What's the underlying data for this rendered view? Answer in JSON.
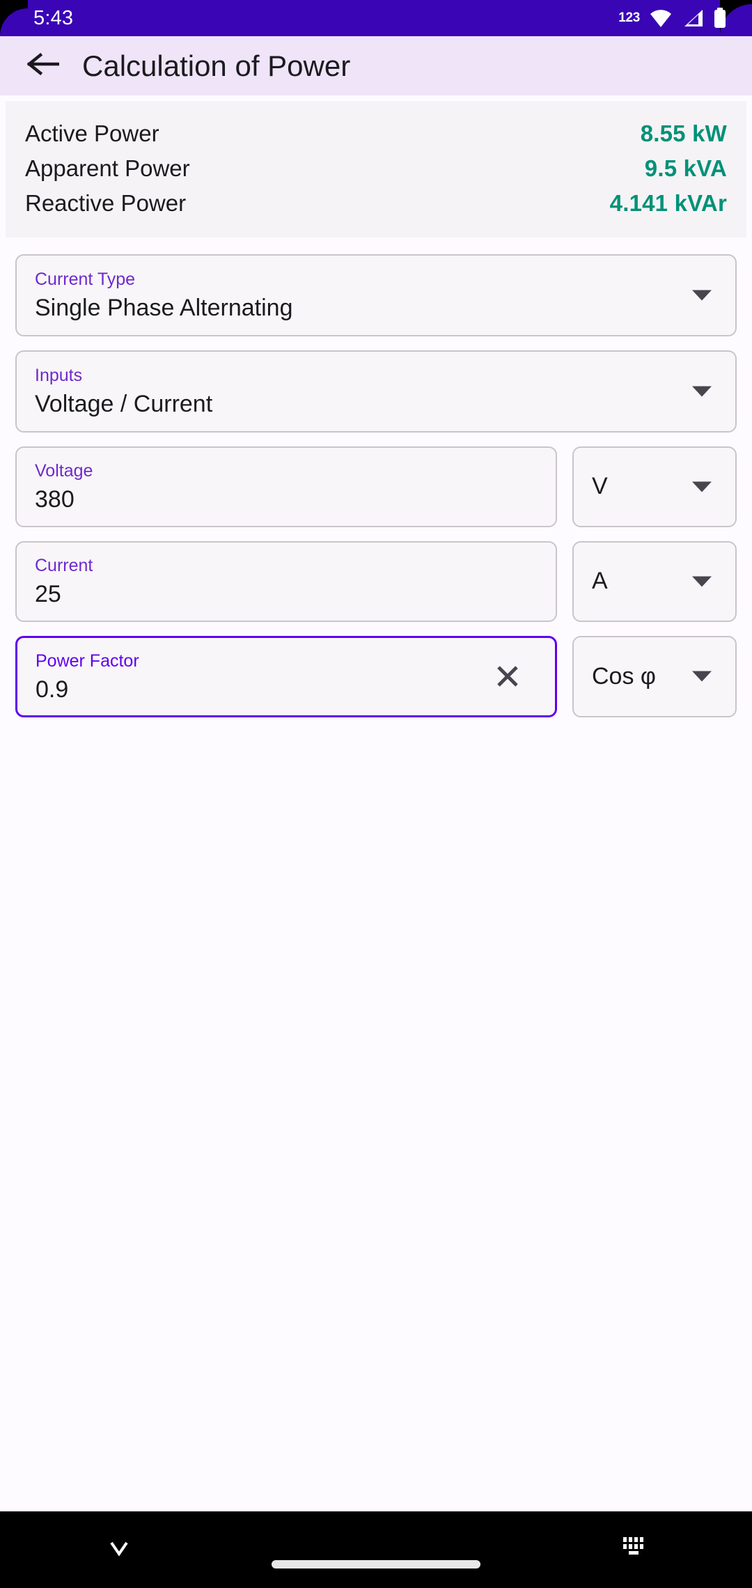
{
  "status_bar": {
    "time": "5:43",
    "badge": "123",
    "icons": [
      "wifi-icon",
      "cellular-signal-icon",
      "battery-icon"
    ],
    "background_color": "#3A05B5"
  },
  "app_bar": {
    "back_label": "Back",
    "title": "Calculation of Power",
    "background_color": "#EFE4F8"
  },
  "results": {
    "accent_color": "#009178",
    "rows": [
      {
        "label": "Active Power",
        "value": "8.55 kW"
      },
      {
        "label": "Apparent Power",
        "value": "9.5 kVA"
      },
      {
        "label": "Reactive Power",
        "value": "4.141 kVAr"
      }
    ]
  },
  "form": {
    "label_color": "#6F2ACD",
    "focus_color": "#6200EE",
    "current_type": {
      "label": "Current Type",
      "value": "Single Phase Alternating"
    },
    "inputs_mode": {
      "label": "Inputs",
      "value": "Voltage / Current"
    },
    "voltage": {
      "label": "Voltage",
      "value": "380",
      "unit": "V"
    },
    "current": {
      "label": "Current",
      "value": "25",
      "unit": "A"
    },
    "power_factor": {
      "label": "Power Factor",
      "value": "0.9",
      "unit": "Cos φ",
      "focused": true,
      "clear_label": "Clear"
    }
  },
  "nav_bar": {
    "hide_keyboard": "hide-keyboard-icon",
    "home_indicator": "home-indicator",
    "keyboard_switcher": "keyboard-icon",
    "background_color": "#000000"
  }
}
